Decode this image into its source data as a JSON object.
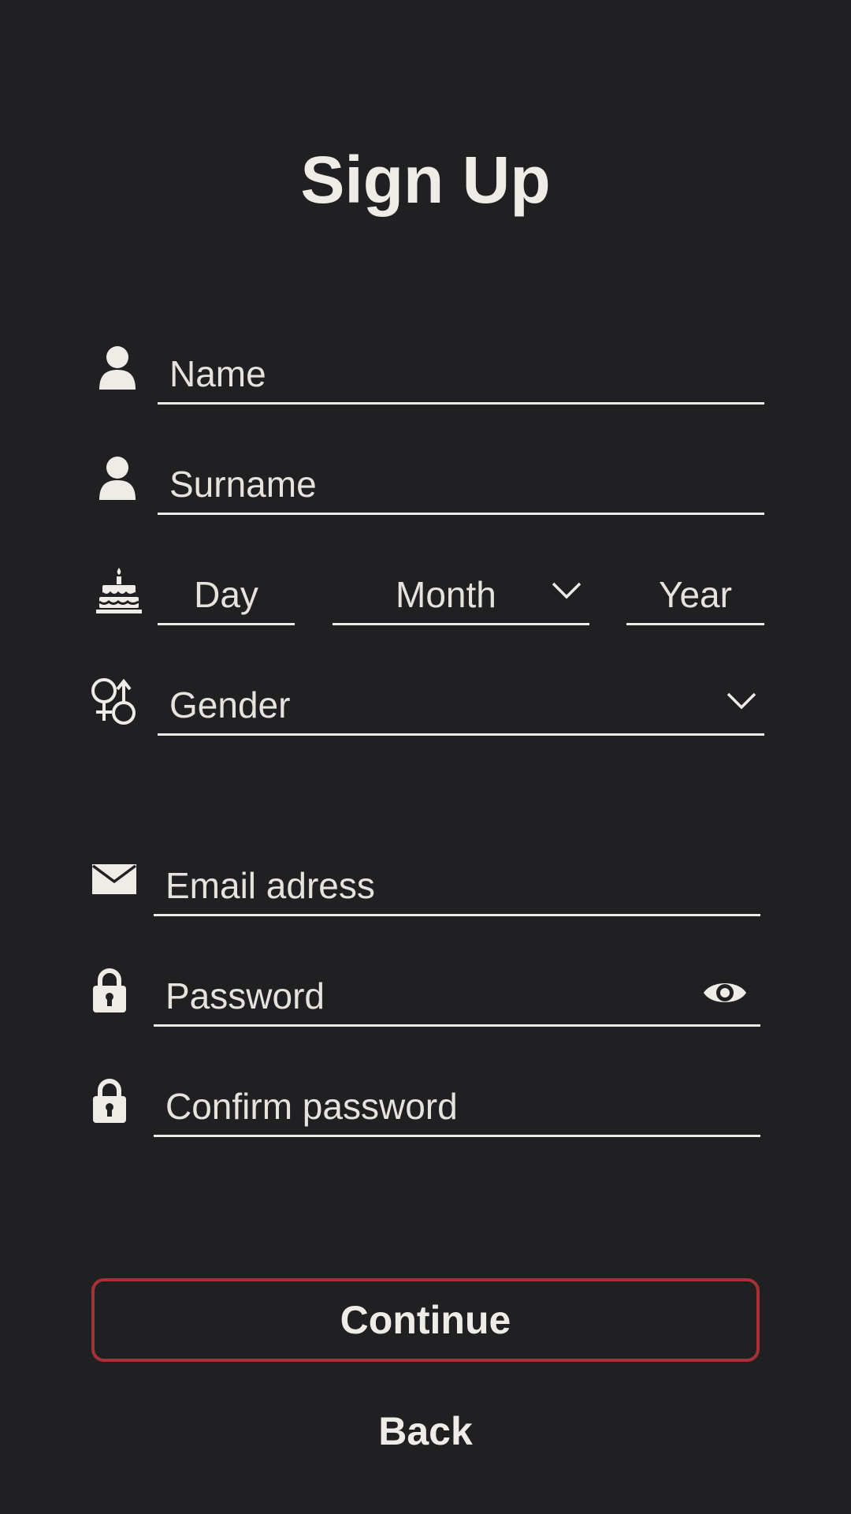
{
  "title": "Sign Up",
  "colors": {
    "background": "#201f21",
    "text": "#efece8",
    "accent_border": "#a5313a"
  },
  "fields": {
    "name": {
      "placeholder": "Name",
      "icon": "person-icon"
    },
    "surname": {
      "placeholder": "Surname",
      "icon": "person-icon"
    },
    "birthdate": {
      "icon": "birthday-cake-icon",
      "day": {
        "placeholder": "Day"
      },
      "month": {
        "placeholder": "Month",
        "icon": "chevron-down-icon"
      },
      "year": {
        "placeholder": "Year"
      }
    },
    "gender": {
      "placeholder": "Gender",
      "icon": "gender-icon",
      "dropdown_icon": "chevron-down-icon"
    },
    "email": {
      "placeholder": "Email adress",
      "icon": "envelope-icon"
    },
    "password": {
      "placeholder": "Password",
      "icon": "lock-icon",
      "toggle_icon": "eye-icon"
    },
    "confirm_password": {
      "placeholder": "Confirm password",
      "icon": "lock-icon"
    }
  },
  "buttons": {
    "continue": "Continue",
    "back": "Back"
  }
}
